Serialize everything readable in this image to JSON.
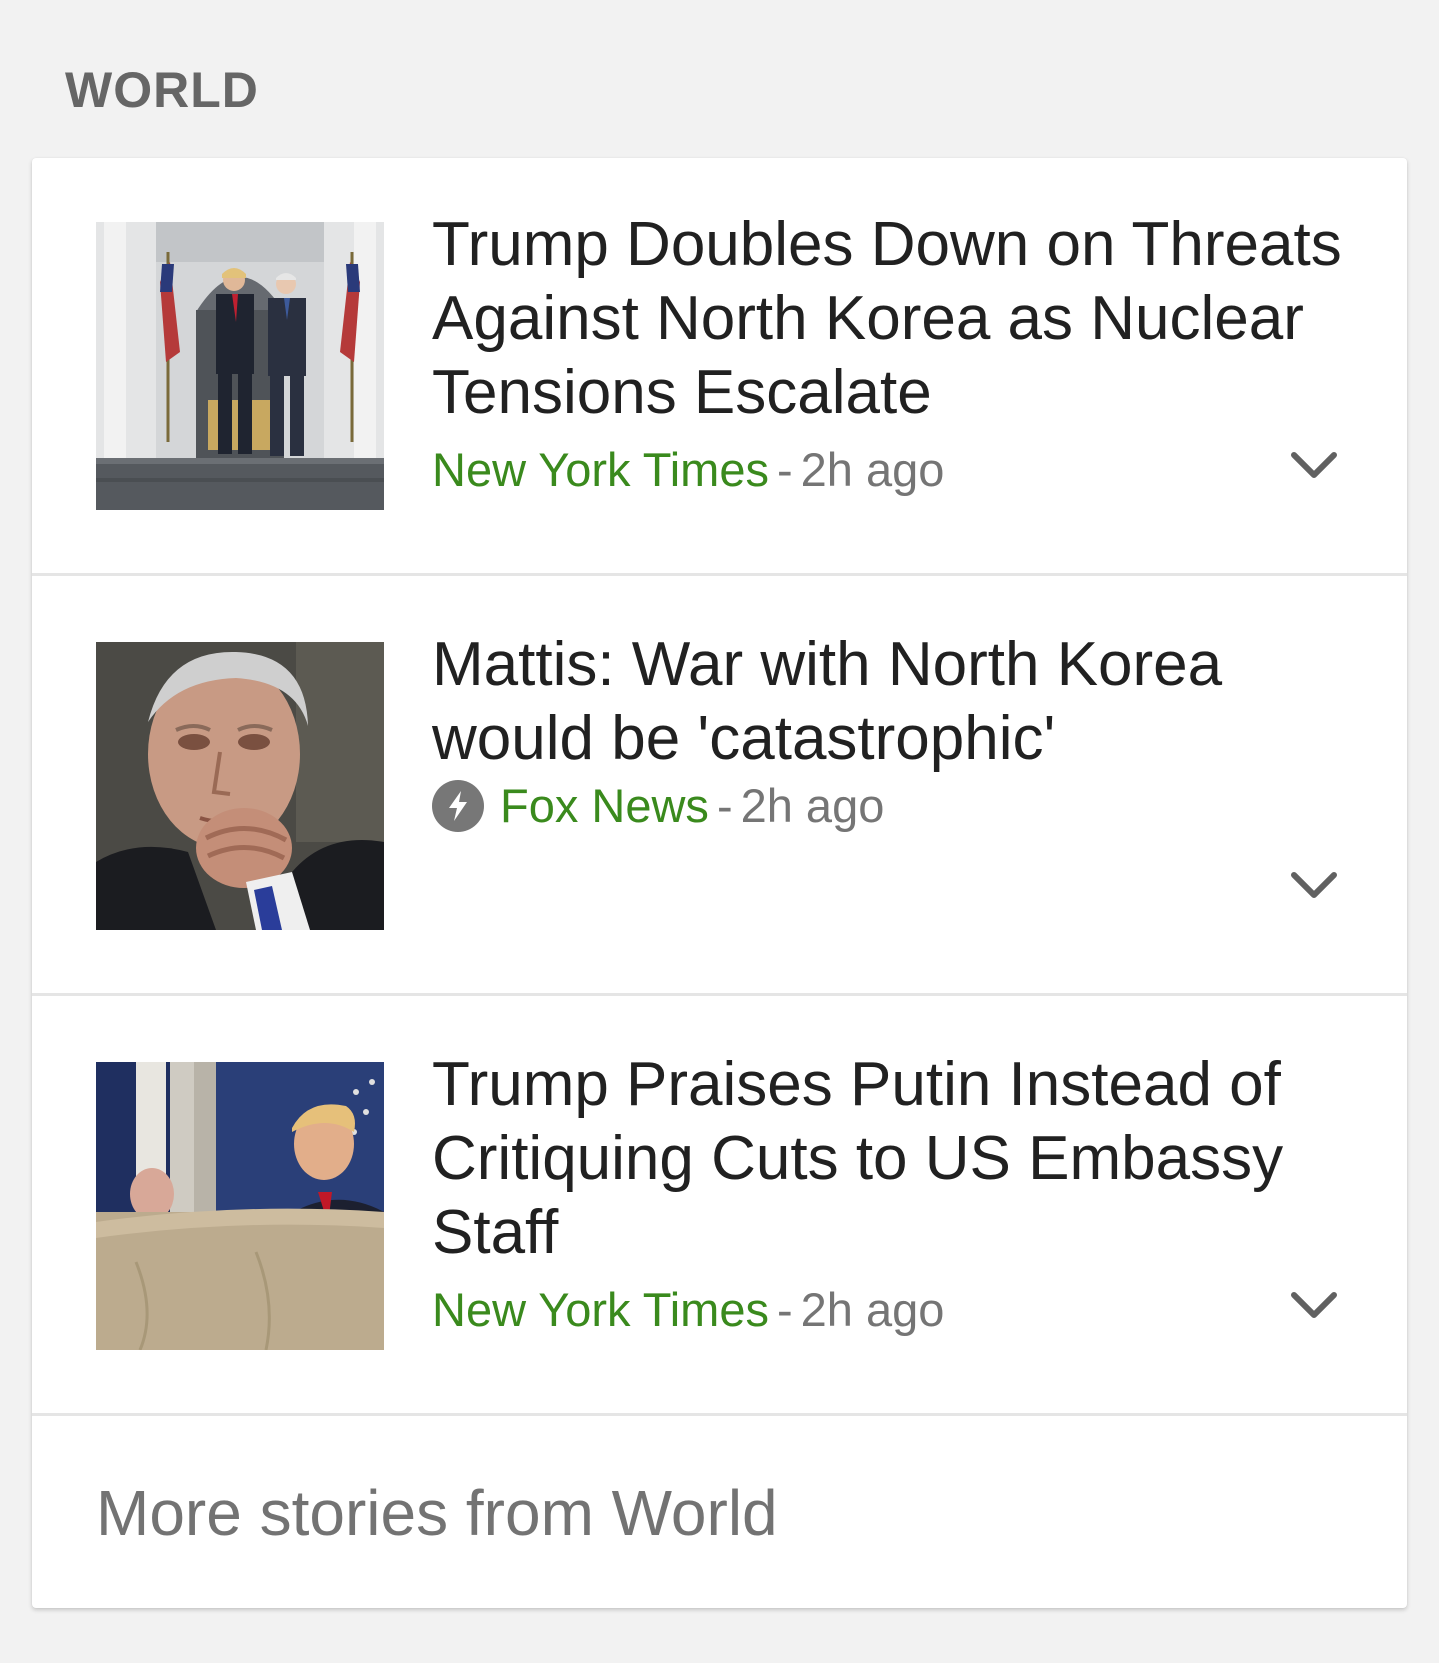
{
  "section": {
    "title": "WORLD"
  },
  "stories": [
    {
      "headline": "Trump Doubles Down on Threats Against North Korea as Nuclear Tensions Escalate",
      "source": "New York Times",
      "separator": "-",
      "time": "2h ago",
      "amp": false,
      "thumbnail": "trump-pence-photo"
    },
    {
      "headline": "Mattis: War with North Korea would be 'catastrophic'",
      "source": "Fox News",
      "separator": "-",
      "time": "2h ago",
      "amp": true,
      "thumbnail": "mattis-portrait-photo"
    },
    {
      "headline": "Trump Praises Putin Instead of Critiquing Cuts to US Embassy Staff",
      "source": "New York Times",
      "separator": "-",
      "time": "2h ago",
      "amp": false,
      "thumbnail": "trump-mcmaster-photo"
    }
  ],
  "footer": {
    "more_label": "More stories from World"
  },
  "colors": {
    "source_green": "#3a8a1d",
    "text_dark": "#212121",
    "text_gray": "#757575",
    "background": "#f2f2f2"
  },
  "icons": {
    "expand": "chevron-down-icon",
    "amp": "lightning-bolt-icon"
  }
}
